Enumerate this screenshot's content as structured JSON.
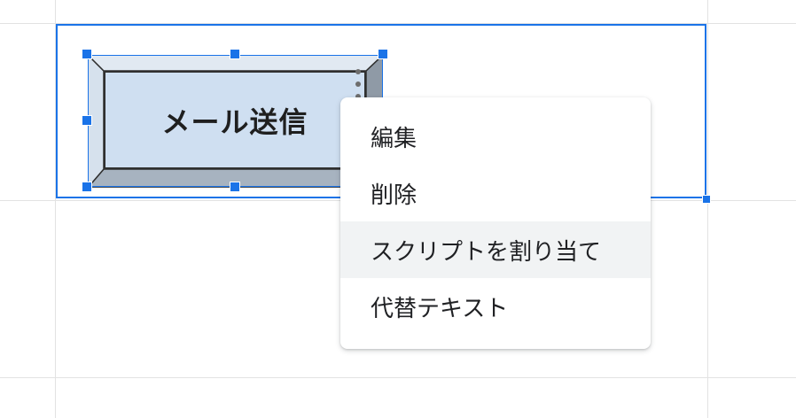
{
  "button": {
    "label": "メール送信"
  },
  "context_menu": {
    "items": [
      {
        "label": "編集",
        "highlighted": false
      },
      {
        "label": "削除",
        "highlighted": false
      },
      {
        "label": "スクリプトを割り当て",
        "highlighted": true
      },
      {
        "label": "代替テキスト",
        "highlighted": false
      }
    ]
  },
  "colors": {
    "selection_accent": "#1a73e8",
    "button_face": "#cfdff1",
    "button_bevel_dark": "#8f9aa6",
    "button_bevel_light": "#b9c5d2",
    "menu_highlight": "#f1f3f4",
    "gridline": "#e2e2e2"
  },
  "icons": {
    "more_menu": "more-vert-icon"
  }
}
